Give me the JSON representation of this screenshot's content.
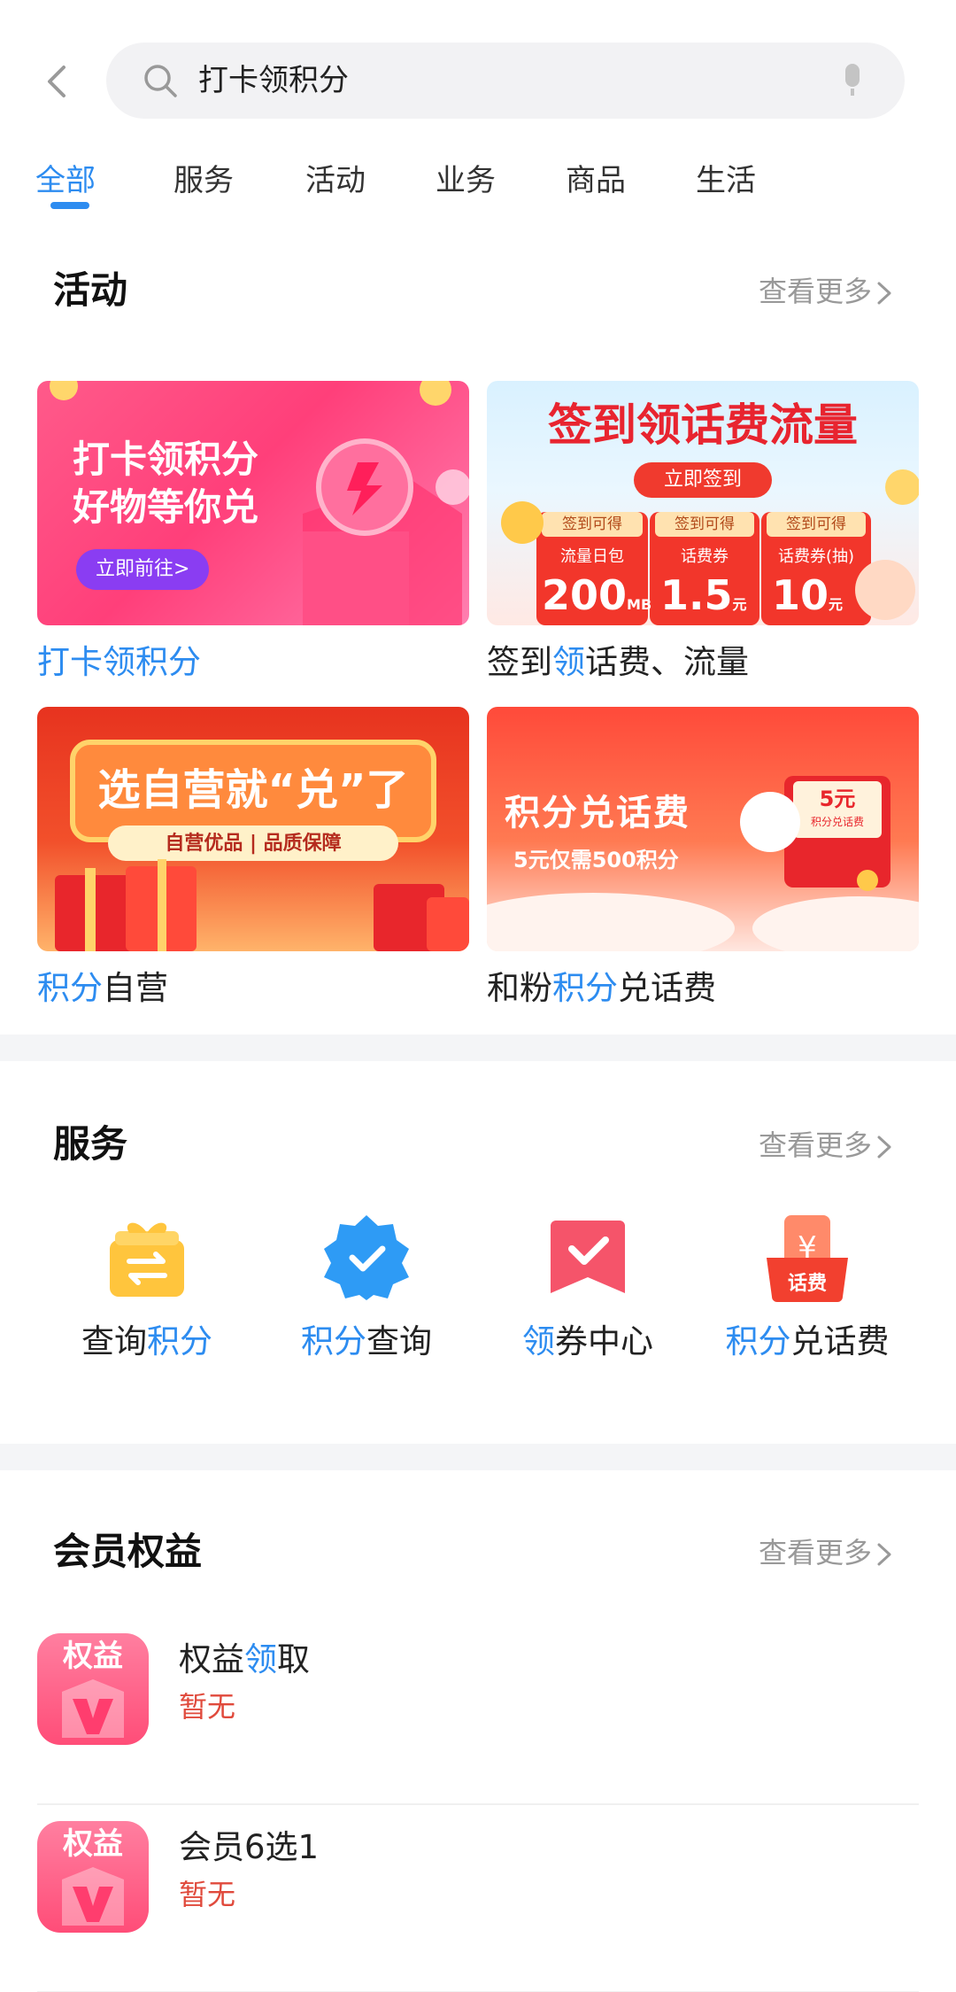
{
  "search": {
    "query": "打卡领积分"
  },
  "tabs": [
    "全部",
    "服务",
    "活动",
    "业务",
    "商品",
    "生活"
  ],
  "activity": {
    "title": "活动",
    "more": "查看更多",
    "cards": [
      {
        "pre": "",
        "hl": "打卡领积分",
        "post": "",
        "banner": {
          "line1": "打卡领积分",
          "line2": "好物等你兑",
          "button": "立即前往>"
        }
      },
      {
        "pre": "签到",
        "hl": "领",
        "post": "话费、流量",
        "banner": {
          "headline": "签到领话费流量",
          "button": "立即签到",
          "items": [
            {
              "tag": "签到可得",
              "name": "流量日包",
              "value": "200",
              "unit": "MB"
            },
            {
              "tag": "签到可得",
              "name": "话费券",
              "value": "1.5",
              "unit": "元"
            },
            {
              "tag": "签到可得",
              "name": "话费券(抽)",
              "value": "10",
              "unit": "元"
            }
          ]
        }
      },
      {
        "pre": "",
        "hl": "积分",
        "post": "自营",
        "banner": {
          "headline": "选自营就“兑”了",
          "sub": "自营优品 | 品质保障"
        }
      },
      {
        "pre": "和粉",
        "hl": "积分",
        "post": "兑话费",
        "banner": {
          "headline": "积分兑话费",
          "sub": "5元仅需500积分",
          "coupon": "5元",
          "coupon_sub": "积分兑话费"
        }
      }
    ]
  },
  "services": {
    "title": "服务",
    "more": "查看更多",
    "items": [
      {
        "pre": "查询",
        "hl": "积分",
        "post": "",
        "icon": "gift-exchange-icon"
      },
      {
        "pre": "",
        "hl": "积分",
        "post": "查询",
        "icon": "verified-badge-icon"
      },
      {
        "pre": "",
        "hl": "领",
        "post": "券中心",
        "icon": "coupon-check-icon"
      },
      {
        "pre": "",
        "hl": "积分",
        "post": "兑话费",
        "icon": "phone-bill-icon"
      }
    ]
  },
  "members": {
    "title": "会员权益",
    "more": "查看更多",
    "badge_text": "权益",
    "items": [
      {
        "pre": "权益",
        "hl": "领",
        "post": "取",
        "status": "暂无"
      },
      {
        "pre": "会员6选1",
        "hl": "",
        "post": "",
        "status": "暂无"
      }
    ]
  },
  "colors": {
    "accent": "#2d8cf0",
    "status": "#e04a3c"
  }
}
